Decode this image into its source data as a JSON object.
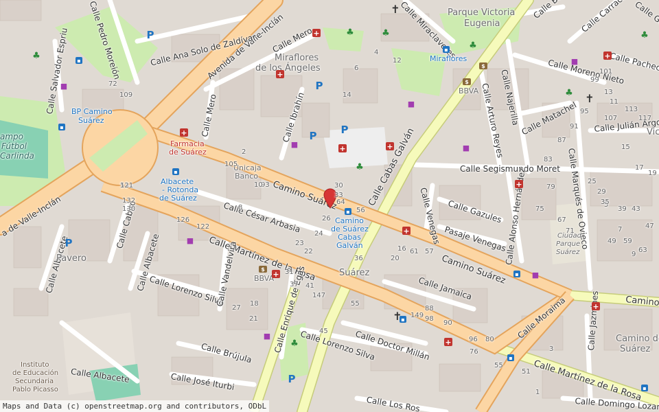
{
  "attribution": {
    "prefix": "Maps and Data (c)",
    "link": "openstreetmap.org",
    "suffix": "and contributors, ODbL"
  },
  "streets": {
    "avenida_valle_inclan_top": "Avenida de Valle-Inclán",
    "avenida_valle_inclan_left": "a de Valle-Inclán",
    "calle_ana_solo": "Calle Ana Solo de Zaldívar",
    "calle_pedro_moreion": "Calle Pedro Moreión",
    "calle_salvador_espriu": "Calle Salvador Espriu",
    "calle_mero_top": "Calle Mero",
    "calle_mero_mid": "Calle Mero",
    "calle_ibrahin": "Calle Ibrahín",
    "camino_suarez_main": "Camino Suárez",
    "camino_suarez_right": "Camino Suárez",
    "camino_suarez_far": "Camino S",
    "calle_cesar_arbasia": "Calle César Arbasia",
    "calle_martinez_rosa_left": "Calle Martínez de la Rosa",
    "calle_martinez_rosa_right": "Calle Martínez de la Rosa",
    "calle_cabiro": "Calle Cabiro",
    "calle_albacete_left": "Calle Albacete",
    "calle_albacete_mid": "Calle Albacete",
    "calle_albacete_bottom": "Calle Albacete",
    "calle_lorenzo_silva_top": "Calle Lorenzo Silva",
    "calle_lorenzo_silva_bottom": "Calle Lorenzo Silva",
    "calle_vandelvira": "Calle Vandelvira",
    "calle_enrique_egas": "Calle Enrique de Egas",
    "calle_brujula": "Calle Brújula",
    "calle_jose_iturbi": "Calle José Iturbi",
    "calle_doctor_millan": "Calle Doctor Millán",
    "calle_jamaica": "Calle Jamaica",
    "calle_moraima": "Calle Moraima",
    "calle_cabas_galvan": "Calle Cabas Galván",
    "calle_venegas": "Calle Venegas",
    "pasaje_venegas": "Pasaje Venegas",
    "calle_gazules": "Calle Gazules",
    "calle_segismundo_moret": "Calle Segismundo Moret",
    "calle_alonso_hernandez": "Calle Alonso Hernández",
    "calle_marques_ovieco": "Calle Marqués de Ovieco",
    "calle_julian_argos": "Calle Julián Argos",
    "calle_matachel": "Calle Matachel",
    "calle_najerilla": "Calle Najerilla",
    "calle_arturo_reyes": "Calle Arturo Reyes",
    "calle_moreno_nieto": "Calle Moreno Nieto",
    "calle_pacheco": "Calle Pacheco",
    "calle_carraca": "Calle Carraca",
    "calle_barca": "Calle Barca",
    "calle_miraclavetes": "Calle Miraclavetes",
    "calle_jazmines": "Calle Jazmines",
    "calle_domingo_lozano": "Calle Domingo Lozano",
    "calle_los_ros": "Calle Los Ros",
    "calle_ga": "Calle Ga"
  },
  "places": {
    "miraflores_angeles_1": "Miraflores",
    "miraflores_angeles_2": "de los Ángeles",
    "parque_victoria_1": "Parque Victoria",
    "parque_victoria_2": "Eugenia",
    "suarez": "Suárez",
    "pavero": "Pavero",
    "camino_de_suarez_1": "Camino de",
    "camino_de_suarez_2": "Suárez",
    "ciudad_parque_1": "Ciudad",
    "ciudad_parque_2": "Parque",
    "ciudad_parque_3": "Suárez",
    "vic": "Vic"
  },
  "pois": {
    "bp_camino_1": "BP Camino",
    "bp_camino_2": "Suárez",
    "farmacia_1": "Farmacia",
    "farmacia_2": "de Suárez",
    "unicaja_1": "Unicaja",
    "unicaja_2": "Banco",
    "albacete_stop_1": "Albacete",
    "albacete_stop_2": "- Rotonda",
    "albacete_stop_3": "de Suárez",
    "camino_stop_1": "Camino",
    "camino_stop_2": "de Suárez",
    "camino_stop_3": "Cabas",
    "camino_stop_4": "Galván",
    "miraflores_stop": "Miraflores",
    "bbva_top": "BBVA",
    "bbva_bottom": "BBVA",
    "campo_futbol_1": "ampo",
    "campo_futbol_2": "Fútbol",
    "campo_futbol_3": "Carlinda",
    "instituto_1": "Instituto",
    "instituto_2": "de Educación",
    "instituto_3": "Secundaria",
    "instituto_4": "Pablo Picasso"
  },
  "house_numbers": [
    "53",
    "130",
    "132",
    "126",
    "122",
    "105",
    "2",
    "93",
    "64",
    "56",
    "26",
    "24",
    "23",
    "22",
    "30",
    "33",
    "36",
    "20",
    "16",
    "61",
    "57",
    "55",
    "147",
    "149",
    "98",
    "88",
    "90",
    "96",
    "80",
    "76",
    "72",
    "109",
    "6",
    "4",
    "12",
    "14",
    "10",
    "8",
    "18",
    "21",
    "27",
    "31",
    "37",
    "41",
    "45",
    "55",
    "51",
    "1",
    "3",
    "5",
    "7",
    "9",
    "11",
    "13",
    "15",
    "17",
    "19",
    "25",
    "29",
    "35",
    "39",
    "43",
    "47",
    "49",
    "59",
    "63",
    "67",
    "71",
    "75",
    "79",
    "83",
    "87",
    "91",
    "95",
    "99",
    "101",
    "107",
    "113",
    "117",
    "121"
  ],
  "colors": {
    "primary_road": "#fcd6a4",
    "primary_casing": "#e4a45c",
    "secondary_road": "#f6fabb",
    "secondary_casing": "#c6cc7a",
    "building": "#d9d0c9",
    "residential": "#e0dad3",
    "park": "#cdebb0",
    "pitch": "#88d1b3",
    "parking": "#eeeeee",
    "pharmacy": "#c1342e",
    "bus": "#1f74c2",
    "marker": "#d73534"
  },
  "icons": {
    "marker": "location-pin-icon",
    "parking": "parking-icon",
    "pharmacy": "pharmacy-icon",
    "bus": "bus-stop-icon",
    "church": "church-icon",
    "bank": "bank-icon",
    "park": "tree-icon",
    "shop": "shop-icon"
  }
}
